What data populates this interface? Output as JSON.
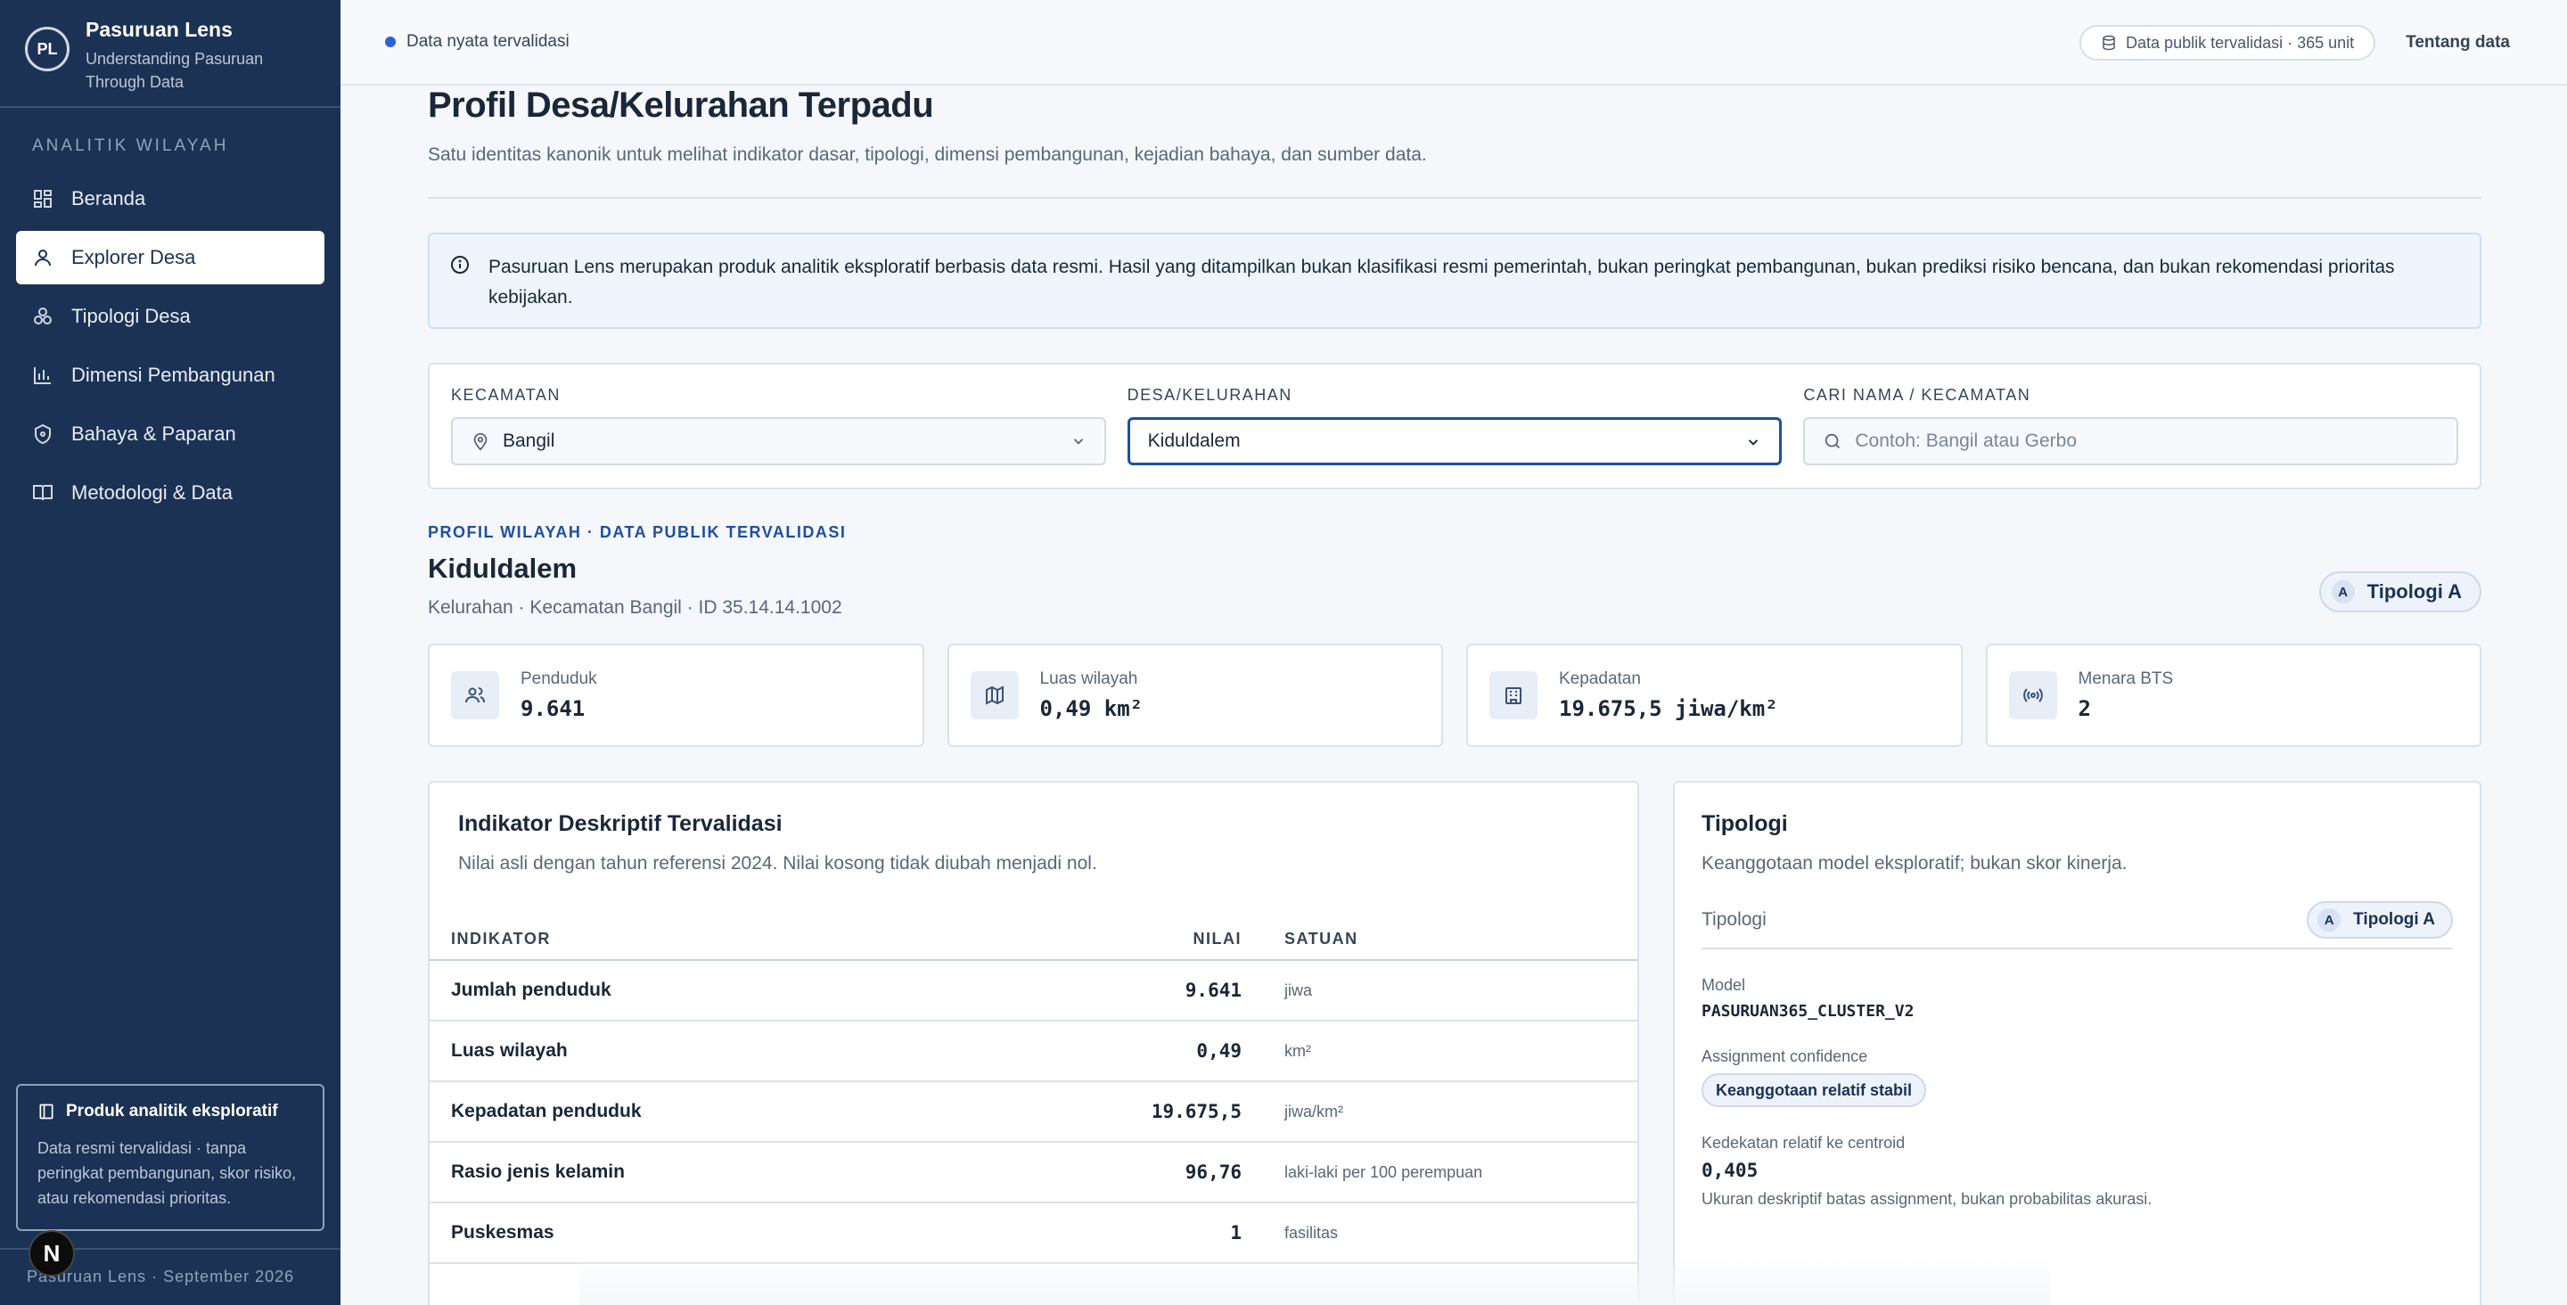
{
  "brand": {
    "logo": "PL",
    "title": "Pasuruan Lens",
    "subtitle": "Understanding Pasuruan Through Data"
  },
  "sidebar": {
    "section": "ANALITIK WILAYAH",
    "items": [
      {
        "label": "Beranda",
        "icon": "grid-icon"
      },
      {
        "label": "Explorer Desa",
        "icon": "user-pin-icon",
        "active": true
      },
      {
        "label": "Tipologi Desa",
        "icon": "cluster-icon"
      },
      {
        "label": "Dimensi Pembangunan",
        "icon": "bar-chart-icon"
      },
      {
        "label": "Bahaya & Paparan",
        "icon": "shield-icon"
      },
      {
        "label": "Metodologi & Data",
        "icon": "book-icon"
      }
    ],
    "card": {
      "title": "Produk analitik eksploratif",
      "text": "Data resmi tervalidasi · tanpa peringkat pembangunan, skor risiko, atau rekomendasi prioritas."
    },
    "footer": "Pasuruan Lens · September 2026",
    "n_badge": "N"
  },
  "topbar": {
    "live": "Data nyata tervalidasi",
    "pill": "Data publik tervalidasi · 365 unit",
    "link": "Tentang data"
  },
  "page": {
    "title": "Profil Desa/Kelurahan Terpadu",
    "subtitle": "Satu identitas kanonik untuk melihat indikator dasar, tipologi, dimensi pembangunan, kejadian bahaya, dan sumber data.",
    "notice": "Pasuruan Lens merupakan produk analitik eksploratif berbasis data resmi. Hasil yang ditampilkan bukan klasifikasi resmi pemerintah, bukan peringkat pembangunan, bukan prediksi risiko bencana, dan bukan rekomendasi prioritas kebijakan."
  },
  "filters": {
    "kecamatan_label": "KECAMATAN",
    "kecamatan_value": "Bangil",
    "desa_label": "DESA/KELURAHAN",
    "desa_value": "Kiduldalem",
    "search_label": "CARI NAMA / KECAMATAN",
    "search_placeholder": "Contoh: Bangil atau Gerbo"
  },
  "profile": {
    "kicker": "PROFIL WILAYAH · DATA PUBLIK TERVALIDASI",
    "name": "Kiduldalem",
    "meta": "Kelurahan · Kecamatan Bangil · ID 35.14.14.1002",
    "tipologi_letter": "A",
    "tipologi_label": "Tipologi A"
  },
  "stats": [
    {
      "label": "Penduduk",
      "value": "9.641"
    },
    {
      "label": "Luas wilayah",
      "value": "0,49 km²"
    },
    {
      "label": "Kepadatan",
      "value": "19.675,5 jiwa/km²"
    },
    {
      "label": "Menara BTS",
      "value": "2"
    }
  ],
  "indicators": {
    "title": "Indikator Deskriptif Tervalidasi",
    "subtitle": "Nilai asli dengan tahun referensi 2024. Nilai kosong tidak diubah menjadi nol.",
    "columns": [
      "INDIKATOR",
      "NILAI",
      "SATUAN"
    ],
    "rows": [
      {
        "name": "Jumlah penduduk",
        "value": "9.641",
        "unit": "jiwa"
      },
      {
        "name": "Luas wilayah",
        "value": "0,49",
        "unit": "km²"
      },
      {
        "name": "Kepadatan penduduk",
        "value": "19.675,5",
        "unit": "jiwa/km²"
      },
      {
        "name": "Rasio jenis kelamin",
        "value": "96,76",
        "unit": "laki-laki per 100 perempuan"
      },
      {
        "name": "Puskesmas",
        "value": "1",
        "unit": "fasilitas"
      }
    ]
  },
  "tipologi": {
    "title": "Tipologi",
    "subtitle": "Keanggotaan model eksploratif; bukan skor kinerja.",
    "row_label": "Tipologi",
    "pill_letter": "A",
    "pill_label": "Tipologi A",
    "model_label": "Model",
    "model_value": "PASURUAN365_CLUSTER_V2",
    "conf_label": "Assignment confidence",
    "conf_value": "Keanggotaan relatif stabil",
    "centroid_label": "Kedekatan relatif ke centroid",
    "centroid_value": "0,405",
    "centroid_note": "Ukuran deskriptif batas assignment, bukan probabilitas akurasi."
  }
}
